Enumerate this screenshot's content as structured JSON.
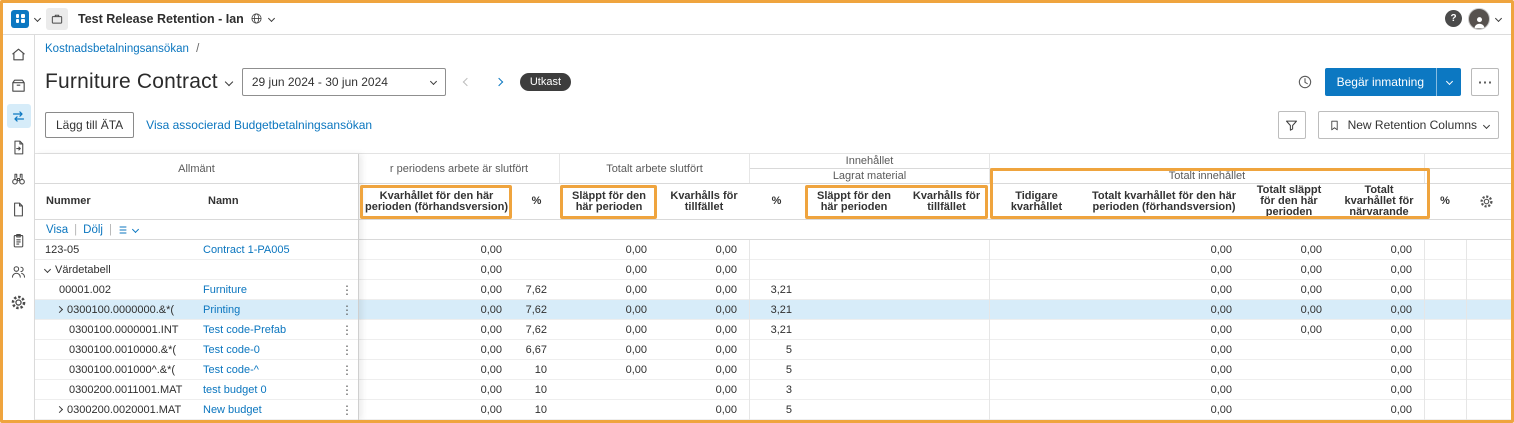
{
  "topbar": {
    "title": "Test Release Retention - Ian"
  },
  "breadcrumb": {
    "link": "Kostnadsbetalningsansökan",
    "separator": "/"
  },
  "page": {
    "title": "Furniture Contract",
    "date_range": "29 jun 2024 - 30 jun 2024",
    "status": "Utkast",
    "request_button": "Begär inmatning",
    "more": "⋯"
  },
  "toolbar": {
    "add_ata": "Lägg till ÄTA",
    "assoc_link": "Visa associerad Budgetbetalningsansökan",
    "columns_preset": "New Retention Columns"
  },
  "table": {
    "groups": {
      "general": "Allmänt",
      "period_done": "r periodens arbete är slutfört",
      "total_done": "Totalt arbete slutfört",
      "content": "Innehållet",
      "stored_material": "Lagrat material",
      "total_content": "Totalt innehållet"
    },
    "headers": {
      "nummer": "Nummer",
      "namn": "Namn",
      "retained_period": "Kvarhållet för den här perioden (förhandsversion)",
      "pct1": "%",
      "released_period": "Släppt för den här perioden",
      "held_currently": "Kvarhålls för tillfället",
      "pct2": "%",
      "sm_released_period": "Släppt för den här perioden",
      "sm_held_currently": "Kvarhålls för tillfället",
      "prev_retained": "Tidigare kvarhållet",
      "total_retained_period": "Totalt kvarhållet för den här perioden (förhandsversion)",
      "total_released_period": "Totalt släppt för den här perioden",
      "total_retained_now": "Totalt kvarhållet för närvarande",
      "pct3": "%"
    },
    "controls": {
      "show": "Visa",
      "hide": "Dölj",
      "sep": "|"
    },
    "rows": [
      {
        "num": "123-05",
        "name": "Contract 1-PA005",
        "caret": "",
        "indent": 0,
        "kebab": false,
        "selected": false,
        "vals": [
          "0,00",
          "",
          "0,00",
          "0,00",
          "",
          "",
          "",
          "",
          "0,00",
          "0,00",
          "0,00",
          ""
        ]
      },
      {
        "num": "Värdetabell",
        "name": "",
        "caret": "down",
        "indent": 0,
        "kebab": false,
        "selected": false,
        "vals": [
          "0,00",
          "",
          "0,00",
          "0,00",
          "",
          "",
          "",
          "",
          "0,00",
          "0,00",
          "0,00",
          ""
        ]
      },
      {
        "num": "00001.002",
        "name": "Furniture",
        "caret": "",
        "indent": 14,
        "kebab": true,
        "selected": false,
        "vals": [
          "0,00",
          "7,62",
          "0,00",
          "0,00",
          "3,21",
          "",
          "",
          "",
          "0,00",
          "0,00",
          "0,00",
          ""
        ]
      },
      {
        "num": "0300100.0000000.&*(",
        "name": "Printing",
        "caret": "right",
        "indent": 12,
        "kebab": true,
        "selected": true,
        "vals": [
          "0,00",
          "7,62",
          "0,00",
          "0,00",
          "3,21",
          "",
          "",
          "",
          "0,00",
          "0,00",
          "0,00",
          ""
        ]
      },
      {
        "num": "0300100.0000001.INT",
        "name": "Test code-Prefab",
        "caret": "",
        "indent": 24,
        "kebab": true,
        "selected": false,
        "vals": [
          "0,00",
          "7,62",
          "0,00",
          "0,00",
          "3,21",
          "",
          "",
          "",
          "0,00",
          "0,00",
          "0,00",
          ""
        ]
      },
      {
        "num": "0300100.0010000.&*(",
        "name": "Test code-0",
        "caret": "",
        "indent": 24,
        "kebab": true,
        "selected": false,
        "vals": [
          "0,00",
          "6,67",
          "0,00",
          "0,00",
          "5",
          "",
          "",
          "",
          "0,00",
          "",
          "0,00",
          ""
        ]
      },
      {
        "num": "0300100.001000^.&*(",
        "name": "Test code-^",
        "caret": "",
        "indent": 24,
        "kebab": true,
        "selected": false,
        "vals": [
          "0,00",
          "10",
          "0,00",
          "0,00",
          "5",
          "",
          "",
          "",
          "0,00",
          "",
          "0,00",
          ""
        ]
      },
      {
        "num": "0300200.0011001.MAT",
        "name": "test budget 0",
        "caret": "",
        "indent": 24,
        "kebab": true,
        "selected": false,
        "vals": [
          "0,00",
          "10",
          "",
          "0,00",
          "3",
          "",
          "",
          "",
          "0,00",
          "",
          "0,00",
          ""
        ]
      },
      {
        "num": "0300200.0020001.MAT",
        "name": "New budget",
        "caret": "right",
        "indent": 12,
        "kebab": true,
        "selected": false,
        "vals": [
          "0,00",
          "10",
          "",
          "0,00",
          "5",
          "",
          "",
          "",
          "0,00",
          "",
          "0,00",
          ""
        ]
      }
    ]
  },
  "glyphs": {
    "kebab": "⋮",
    "help": "?"
  },
  "colors": {
    "accent_blue": "#0c78c2",
    "annotation_orange": "#efa43e",
    "selected_row": "#d7ecf9",
    "badge_dark": "#3d3d3d"
  }
}
